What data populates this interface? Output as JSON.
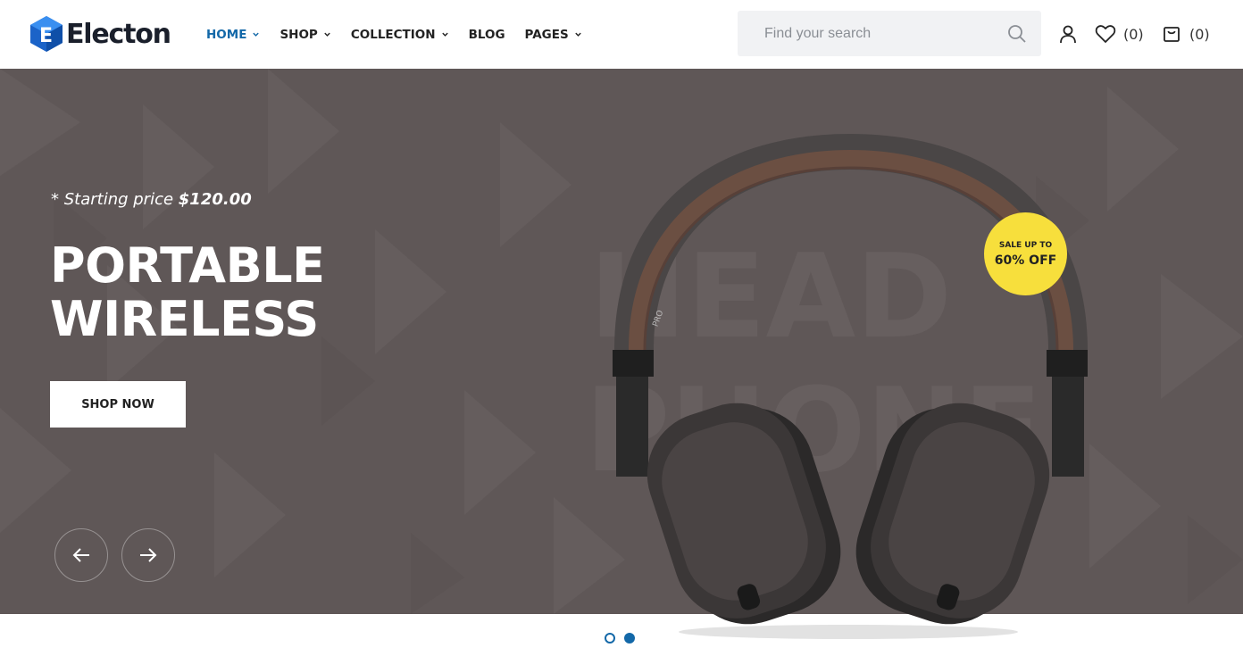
{
  "brand": {
    "name": "Electon",
    "accent": "#1368a8"
  },
  "nav": [
    {
      "label": "HOME",
      "dropdown": true,
      "active": true
    },
    {
      "label": "SHOP",
      "dropdown": true
    },
    {
      "label": "COLLECTION",
      "dropdown": true
    },
    {
      "label": "BLOG",
      "dropdown": false
    },
    {
      "label": "PAGES",
      "dropdown": true
    }
  ],
  "search": {
    "placeholder": "Find your search",
    "icon": "search-icon"
  },
  "header_actions": {
    "account_icon": "user-icon",
    "wishlist_icon": "heart-icon",
    "wishlist_count": "(0)",
    "cart_icon": "shopping-bag-icon",
    "cart_count": "(0)"
  },
  "hero": {
    "starting_prefix": "* Starting price ",
    "starting_price": "$120.00",
    "headline_line1": "PORTABLE",
    "headline_line2": "WIRELESS",
    "cta_label": "SHOP NOW",
    "background_color": "#5f5757",
    "watermark_line1": "HEAD",
    "watermark_line2": "PHONE",
    "badge": {
      "small": "SALE UP TO",
      "big": "60% OFF",
      "color": "#f7df3c"
    },
    "product_label": "PRO"
  },
  "slider": {
    "prev_icon": "arrow-left-icon",
    "next_icon": "arrow-right-icon",
    "total_slides": 2,
    "active_slide": 2
  }
}
